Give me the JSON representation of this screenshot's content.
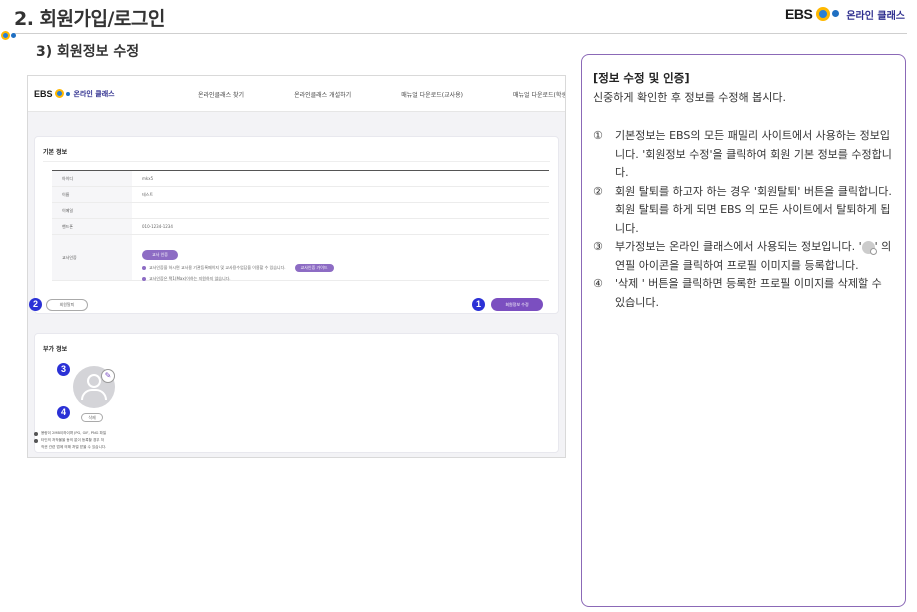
{
  "header": {
    "title": "2. 회원가입/로그인",
    "brand_ebs": "EBS",
    "brand_text": "온라인 클래스",
    "subtitle": "3) 회원정보 수정"
  },
  "screenshot": {
    "nav": {
      "logo_ebs": "EBS",
      "logo_text": "온라인 클래스",
      "menu": [
        "온라인클래스 찾기",
        "온라인클래스 개설하기",
        "매뉴얼 다운로드(교사용)",
        "매뉴얼 다운로드(학생용)"
      ]
    },
    "basic_info": {
      "title": "기본 정보",
      "rows": [
        {
          "label": "아이디",
          "value": "mkx5"
        },
        {
          "label": "이름",
          "value": "테스트"
        },
        {
          "label": "이메일",
          "value": ""
        },
        {
          "label": "핸드폰",
          "value": "010-1234-1234"
        }
      ],
      "teacher_cert": {
        "label": "교사인증",
        "button": "교사 인증",
        "note1": "교사인증을 하시면 교사용 기관등록페이지 및 교사용수업담을 이용할 수 있습니다.",
        "guide_button": "교사인증 가이드",
        "note2": "교사인증은 택1(Max)이하는 지원하지 않습니다."
      },
      "withdraw_button": "회원탈퇴",
      "edit_button": "회원정보 수정"
    },
    "extra_info": {
      "title": "부가 정보",
      "delete_button": "삭제",
      "notes": [
        "용량이 2MB이하이며 JPG, GIF, PNG 파일",
        "타인의 저작물을 동의 없이 등록할 경우 저",
        "작권 관련 법에 의해 처벌 받을 수 있습니다."
      ]
    },
    "badges": [
      "1",
      "2",
      "3",
      "4"
    ]
  },
  "description": {
    "heading": "[정보 수정 및 인증]",
    "sub": "신중하게 확인한 후 정보를 수정해 봅시다.",
    "items": [
      {
        "num": "①",
        "text": "기본정보는 EBS의 모든 패밀리 사이트에서 사용하는 정보입니다. '회원정보 수정'을 클릭하여 회원 기본 정보를 수정합니다."
      },
      {
        "num": "②",
        "text": "회원 탈퇴를 하고자 하는 경우 '회원탈퇴' 버튼을 클릭합니다. 회원 탈퇴를 하게 되면 EBS 의 모든 사이트에서 탈퇴하게 됩니다."
      },
      {
        "num": "③",
        "text_before": "부가정보는 온라인 클래스에서 사용되는 정보입니다. '",
        "text_after": "' 의 연필 아이콘을 클릭하여 프로필 이미지를 등록합니다."
      },
      {
        "num": "④",
        "text": "'삭제 '  버튼을 클릭하면 등록한 프로필 이미지를 삭제할 수 있습니다."
      }
    ]
  },
  "colors": {
    "accent": "#7b4fc0",
    "badge": "#2b31d6",
    "border": "#8b69b7"
  }
}
